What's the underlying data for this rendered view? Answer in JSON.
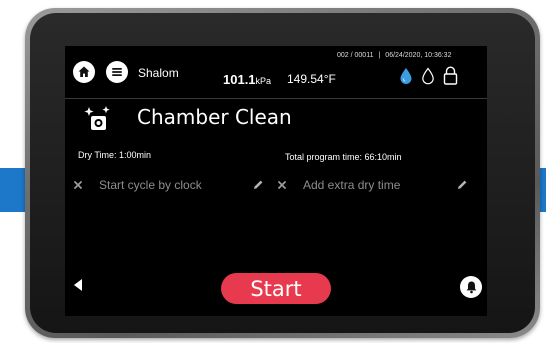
{
  "status_bar": {
    "user_name": "Shalom",
    "pressure_value": "101.1",
    "pressure_unit": "kPa",
    "temperature": "149.54°F",
    "cycle_counter": "002 / 00011",
    "separator": "|",
    "datetime": "06/24/2020, 10:36:32",
    "icons": [
      "home-icon",
      "menu-icon",
      "water-drop-filled-icon",
      "water-drop-outline-icon",
      "lock-open-icon"
    ]
  },
  "program": {
    "icon": "sparkle-chamber-icon",
    "title": "Chamber Clean"
  },
  "times": {
    "dry_time": "Dry Time: 1:00min",
    "total_program_time": "Total program time: 66:10min"
  },
  "options": [
    {
      "label": "Start cycle by clock",
      "icons": [
        "close-icon",
        "pencil-icon"
      ]
    },
    {
      "label": "Add extra dry time",
      "icons": [
        "close-icon",
        "pencil-icon"
      ]
    }
  ],
  "controls": {
    "start_label": "Start",
    "back_icon": "back-arrow-icon",
    "bell_icon": "bell-icon"
  },
  "colors": {
    "accent_start": "#e83a4e",
    "water_drop": "#3d9be0",
    "brand_blue": "#1d78c9",
    "screen_background": "#000000"
  }
}
